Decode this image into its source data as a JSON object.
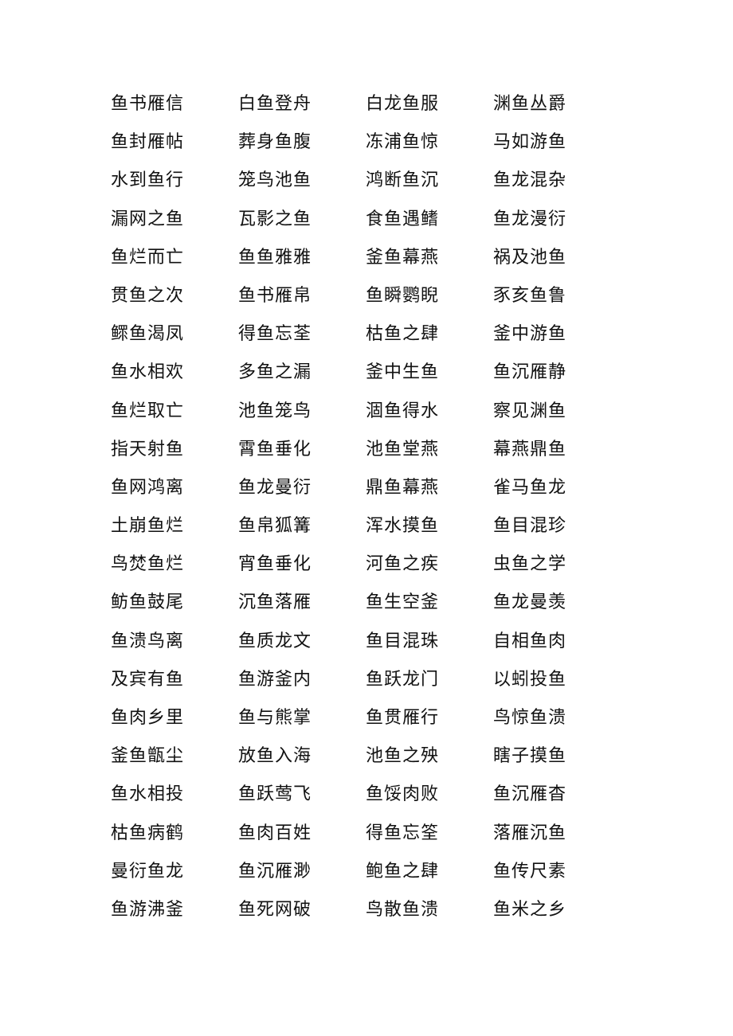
{
  "document": {
    "idioms": [
      [
        "鱼书雁信",
        "白鱼登舟",
        "白龙鱼服",
        "渊鱼丛爵"
      ],
      [
        "鱼封雁帖",
        "葬身鱼腹",
        "冻浦鱼惊",
        "马如游鱼"
      ],
      [
        "水到鱼行",
        "笼鸟池鱼",
        "鸿断鱼沉",
        "鱼龙混杂"
      ],
      [
        "漏网之鱼",
        "瓦影之鱼",
        "食鱼遇鳍",
        "鱼龙漫衍"
      ],
      [
        "鱼烂而亡",
        "鱼鱼雅雅",
        "釜鱼幕燕",
        "祸及池鱼"
      ],
      [
        "贯鱼之次",
        "鱼书雁帛",
        "鱼瞬鹦睨",
        "豕亥鱼鲁"
      ],
      [
        "鳏鱼渴凤",
        "得鱼忘荃",
        "枯鱼之肆",
        "釜中游鱼"
      ],
      [
        "鱼水相欢",
        "多鱼之漏",
        "釜中生鱼",
        "鱼沉雁静"
      ],
      [
        "鱼烂取亡",
        "池鱼笼鸟",
        "涸鱼得水",
        "察见渊鱼"
      ],
      [
        "指天射鱼",
        "霄鱼垂化",
        "池鱼堂燕",
        "幕燕鼎鱼"
      ],
      [
        "鱼网鸿离",
        "鱼龙曼衍",
        "鼎鱼幕燕",
        "雀马鱼龙"
      ],
      [
        "土崩鱼烂",
        "鱼帛狐篝",
        "浑水摸鱼",
        "鱼目混珍"
      ],
      [
        "鸟焚鱼烂",
        "宵鱼垂化",
        "河鱼之疾",
        "虫鱼之学"
      ],
      [
        "鲂鱼鼓尾",
        "沉鱼落雁",
        "鱼生空釜",
        "鱼龙曼羡"
      ],
      [
        "鱼溃鸟离",
        "鱼质龙文",
        "鱼目混珠",
        "自相鱼肉"
      ],
      [
        "及宾有鱼",
        "鱼游釜内",
        "鱼跃龙门",
        "以蚓投鱼"
      ],
      [
        "鱼肉乡里",
        "鱼与熊掌",
        "鱼贯雁行",
        "鸟惊鱼溃"
      ],
      [
        "釜鱼甑尘",
        "放鱼入海",
        "池鱼之殃",
        "瞎子摸鱼"
      ],
      [
        "鱼水相投",
        "鱼跃莺飞",
        "鱼馁肉败",
        "鱼沉雁杳"
      ],
      [
        "枯鱼病鹤",
        "鱼肉百姓",
        "得鱼忘筌",
        "落雁沉鱼"
      ],
      [
        "曼衍鱼龙",
        "鱼沉雁渺",
        "鲍鱼之肆",
        "鱼传尺素"
      ],
      [
        "鱼游沸釜",
        "鱼死网破",
        "鸟散鱼溃",
        "鱼米之乡"
      ]
    ]
  }
}
